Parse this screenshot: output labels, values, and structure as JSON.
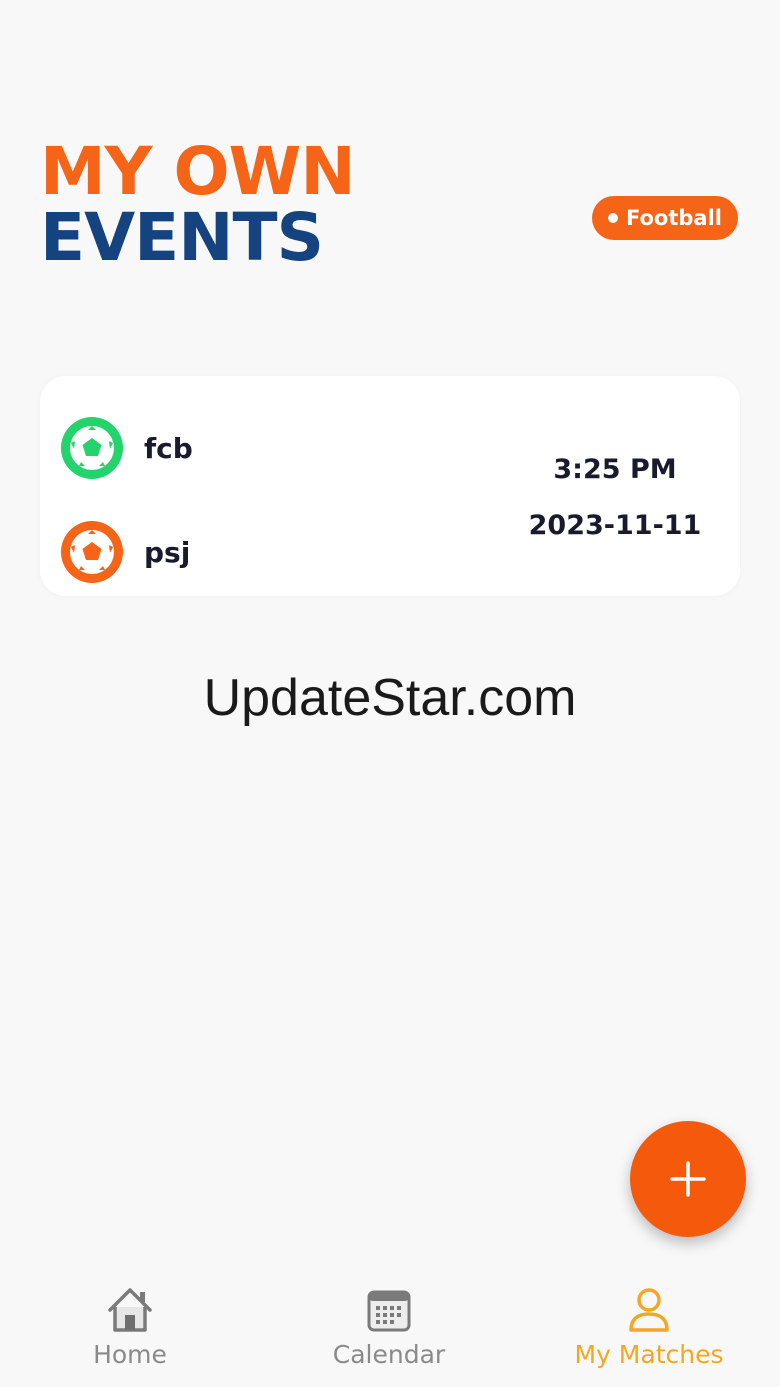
{
  "header": {
    "title_line1": "MY OWN",
    "title_line2": "EVENTS",
    "sport_filter": "Football"
  },
  "match": {
    "home_team": "fcb",
    "away_team": "psj",
    "time": "3:25 PM",
    "date": "2023-11-11",
    "home_color": "#22d46b",
    "away_color": "#f56417"
  },
  "watermark": "UpdateStar.com",
  "fab": {
    "icon": "plus-icon"
  },
  "nav": {
    "items": [
      {
        "label": "Home",
        "icon": "home-icon",
        "active": false
      },
      {
        "label": "Calendar",
        "icon": "calendar-icon",
        "active": false
      },
      {
        "label": "My Matches",
        "icon": "person-icon",
        "active": true
      }
    ],
    "active_color": "#f5a623"
  },
  "colors": {
    "accent": "#f56417",
    "navy": "#14437f"
  }
}
